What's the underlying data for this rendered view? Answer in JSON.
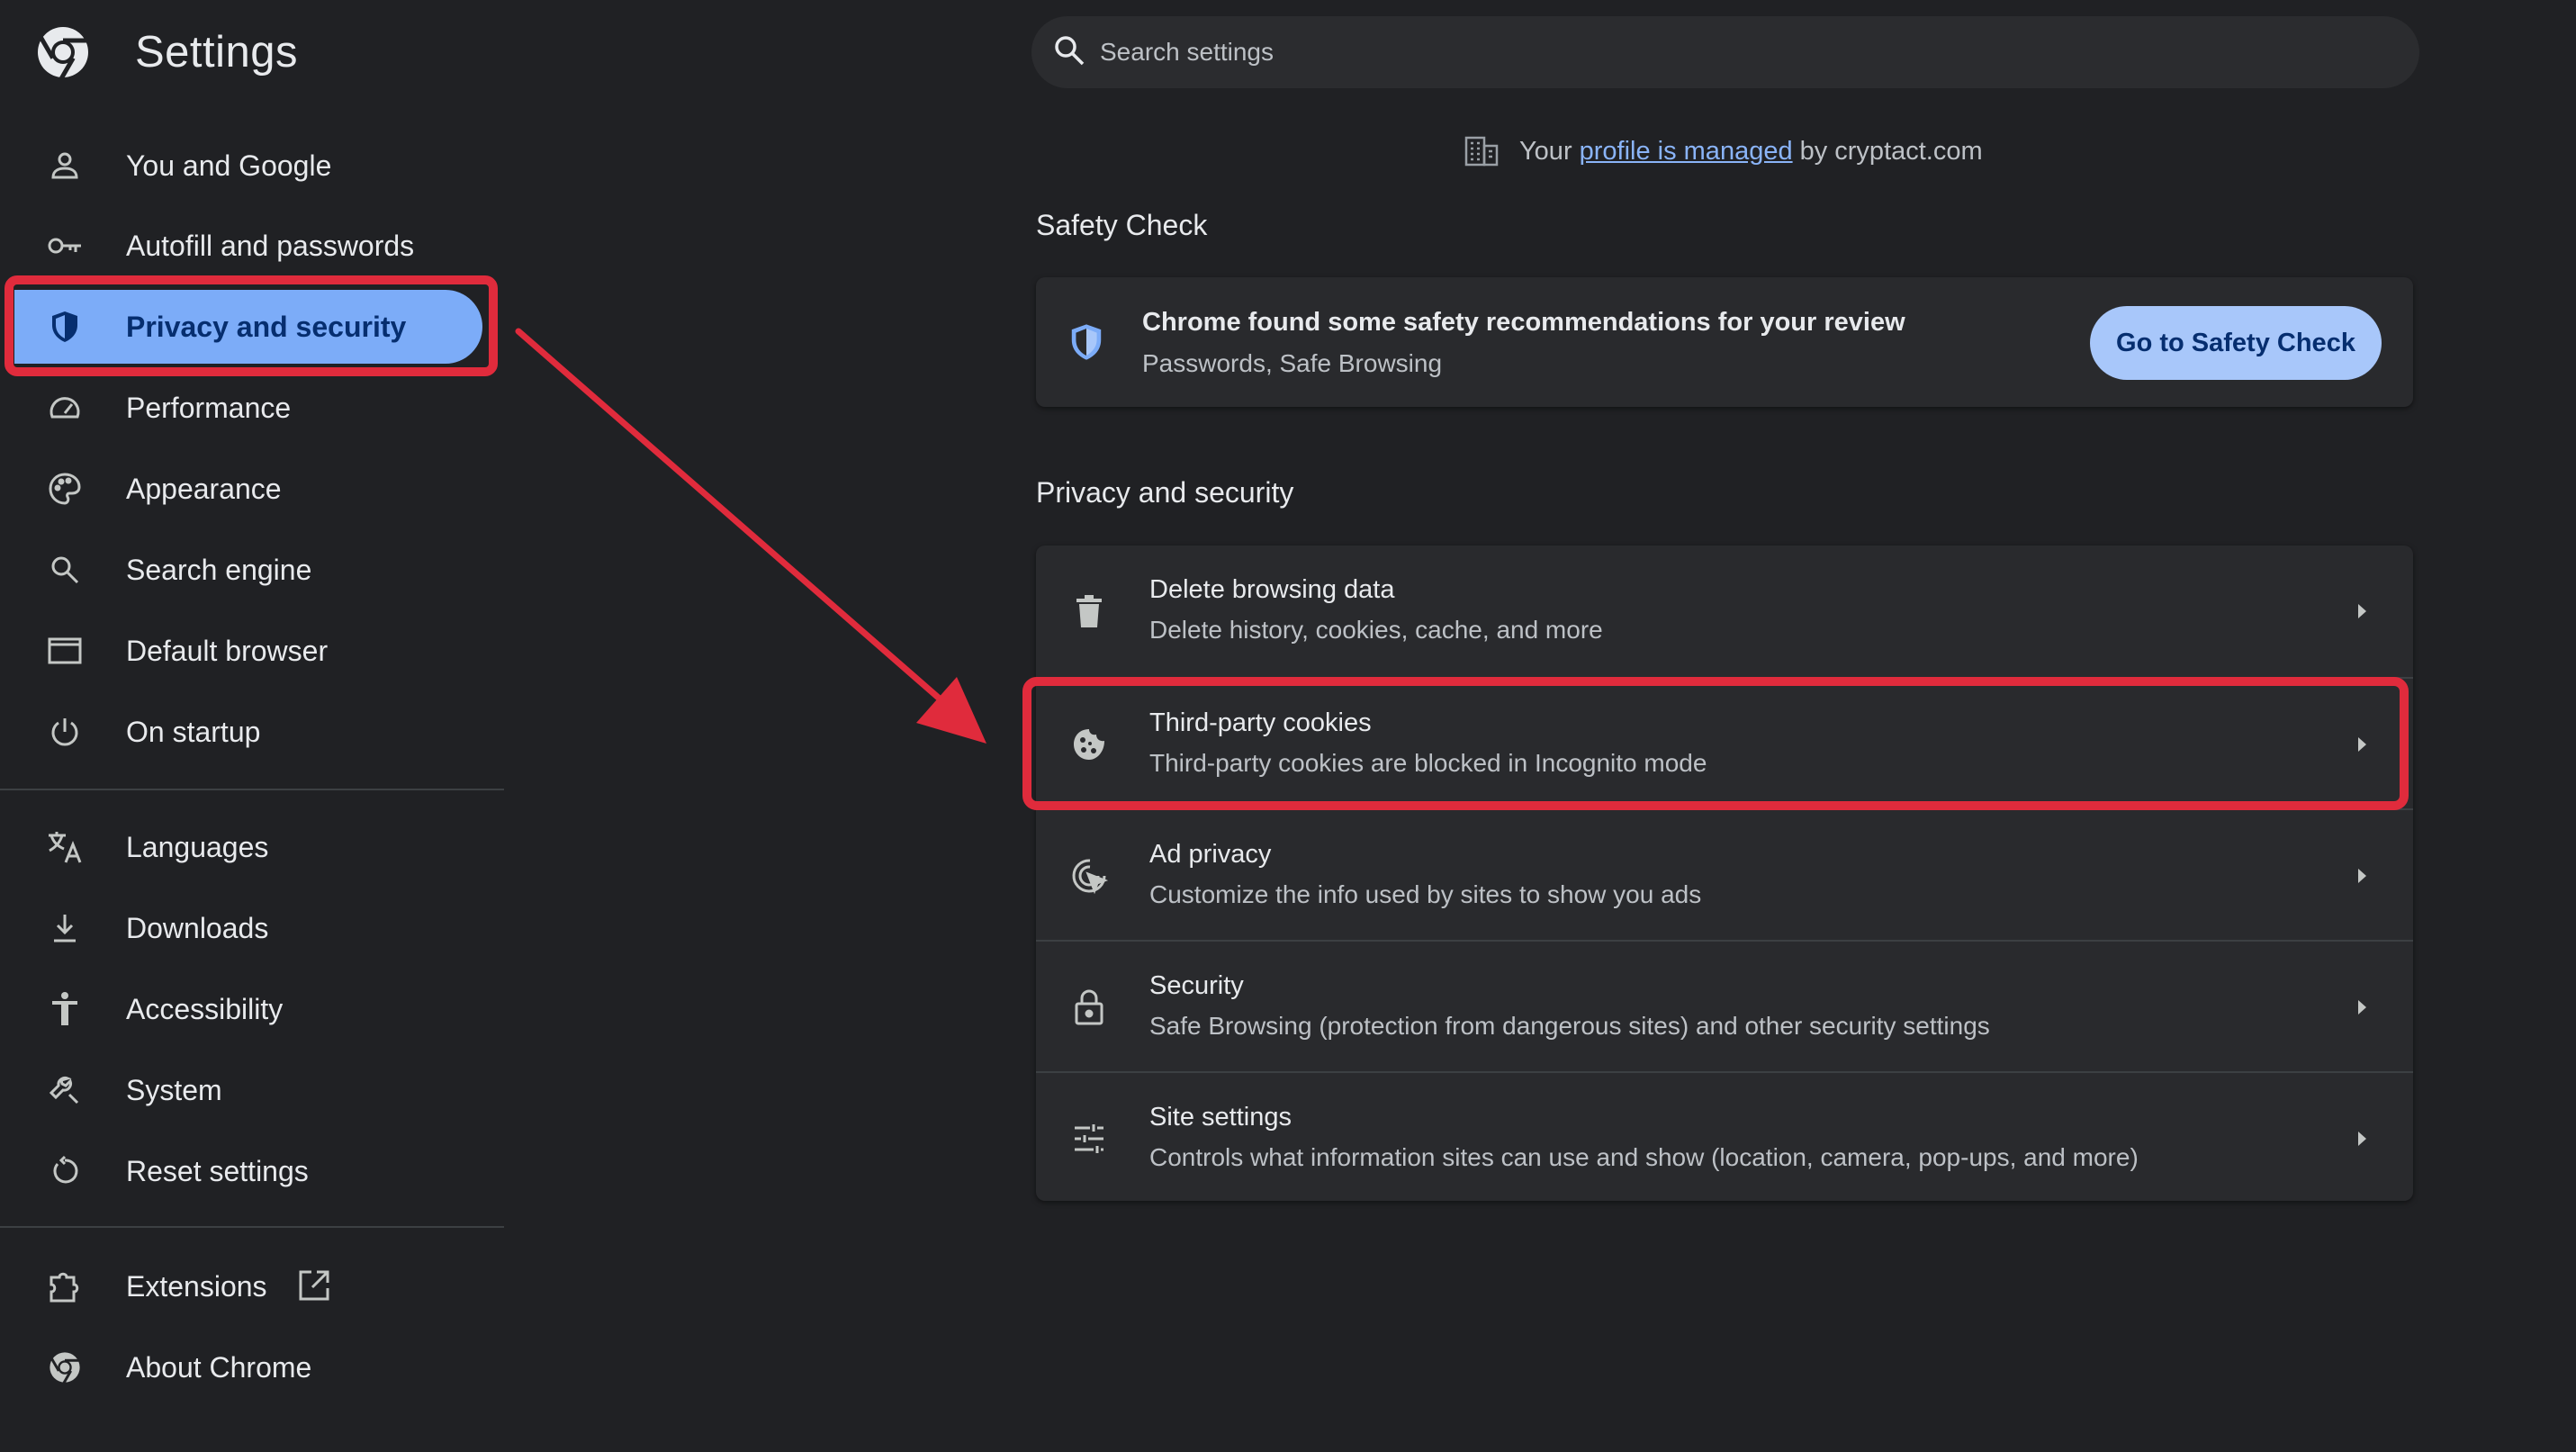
{
  "app": {
    "title": "Settings",
    "logo_icon": "chrome-logo-icon"
  },
  "sidebar": {
    "items": [
      {
        "label": "You and Google",
        "icon": "person-icon"
      },
      {
        "label": "Autofill and passwords",
        "icon": "key-icon"
      },
      {
        "label": "Privacy and security",
        "icon": "shield-icon",
        "selected": true
      },
      {
        "label": "Performance",
        "icon": "speedometer-icon"
      },
      {
        "label": "Appearance",
        "icon": "palette-icon"
      },
      {
        "label": "Search engine",
        "icon": "search-icon"
      },
      {
        "label": "Default browser",
        "icon": "browser-window-icon"
      },
      {
        "label": "On startup",
        "icon": "power-icon"
      },
      {
        "label": "Languages",
        "icon": "translate-icon"
      },
      {
        "label": "Downloads",
        "icon": "download-icon"
      },
      {
        "label": "Accessibility",
        "icon": "accessibility-icon"
      },
      {
        "label": "System",
        "icon": "wrench-icon"
      },
      {
        "label": "Reset settings",
        "icon": "reset-icon"
      },
      {
        "label": "Extensions",
        "icon": "puzzle-icon",
        "trailing_icon": "open-in-new-icon"
      },
      {
        "label": "About Chrome",
        "icon": "chrome-logo-icon"
      }
    ]
  },
  "search": {
    "placeholder": "Search settings"
  },
  "managed": {
    "prefix": "Your",
    "link": "profile is managed",
    "suffix": "by cryptact.com"
  },
  "safety_check": {
    "section_title": "Safety Check",
    "primary": "Chrome found some safety recommendations for your review",
    "secondary": "Passwords, Safe Browsing",
    "button": "Go to Safety Check"
  },
  "privacy": {
    "section_title": "Privacy and security",
    "rows": [
      {
        "title": "Delete browsing data",
        "subtitle": "Delete history, cookies, cache, and more",
        "icon": "trash-icon"
      },
      {
        "title": "Third-party cookies",
        "subtitle": "Third-party cookies are blocked in Incognito mode",
        "icon": "cookie-icon",
        "highlighted": true
      },
      {
        "title": "Ad privacy",
        "subtitle": "Customize the info used by sites to show you ads",
        "icon": "ad-privacy-icon"
      },
      {
        "title": "Security",
        "subtitle": "Safe Browsing (protection from dangerous sites) and other security settings",
        "icon": "lock-icon"
      },
      {
        "title": "Site settings",
        "subtitle": "Controls what information sites can use and show (location, camera, pop-ups, and more)",
        "icon": "sliders-icon"
      }
    ]
  },
  "colors": {
    "background": "#202124",
    "card": "#292a2d",
    "accent": "#7cacf8",
    "button": "#a8c7fa",
    "annotation": "#e02b3c",
    "link": "#8ab4f8"
  }
}
